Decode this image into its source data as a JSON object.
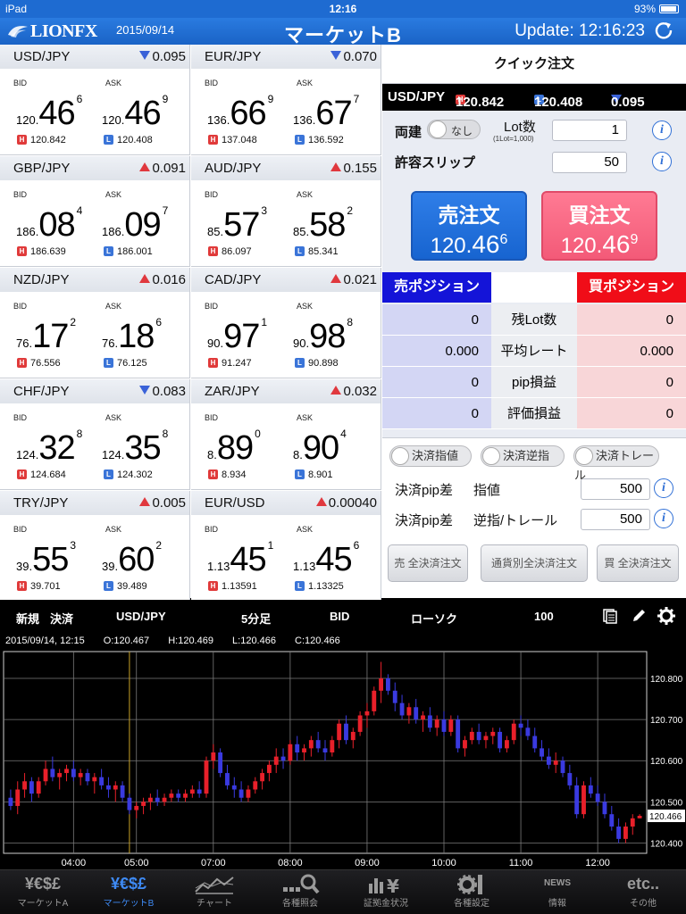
{
  "status": {
    "device": "iPad",
    "time": "12:16",
    "battery": "93%"
  },
  "header": {
    "logo": "LIONFX",
    "date": "2015/09/14",
    "title": "マーケットB",
    "update": "Update: 12:16:23"
  },
  "labels": {
    "bid": "BID",
    "ask": "ASK",
    "h": "H",
    "l": "L"
  },
  "rates": [
    {
      "pair": "USD/JPY",
      "dir": "down",
      "change": "0.095",
      "bid": {
        "a": "120.",
        "b": "46",
        "c": "6"
      },
      "ask": {
        "a": "120.",
        "b": "46",
        "c": "9"
      },
      "high": "120.842",
      "low": "120.408"
    },
    {
      "pair": "EUR/JPY",
      "dir": "down",
      "change": "0.070",
      "bid": {
        "a": "136.",
        "b": "66",
        "c": "9"
      },
      "ask": {
        "a": "136.",
        "b": "67",
        "c": "7"
      },
      "high": "137.048",
      "low": "136.592"
    },
    {
      "pair": "GBP/JPY",
      "dir": "up",
      "change": "0.091",
      "bid": {
        "a": "186.",
        "b": "08",
        "c": "4"
      },
      "ask": {
        "a": "186.",
        "b": "09",
        "c": "7"
      },
      "high": "186.639",
      "low": "186.001"
    },
    {
      "pair": "AUD/JPY",
      "dir": "up",
      "change": "0.155",
      "bid": {
        "a": "85.",
        "b": "57",
        "c": "3"
      },
      "ask": {
        "a": "85.",
        "b": "58",
        "c": "2"
      },
      "high": "86.097",
      "low": "85.341"
    },
    {
      "pair": "NZD/JPY",
      "dir": "up",
      "change": "0.016",
      "bid": {
        "a": "76.",
        "b": "17",
        "c": "2"
      },
      "ask": {
        "a": "76.",
        "b": "18",
        "c": "6"
      },
      "high": "76.556",
      "low": "76.125"
    },
    {
      "pair": "CAD/JPY",
      "dir": "up",
      "change": "0.021",
      "bid": {
        "a": "90.",
        "b": "97",
        "c": "1"
      },
      "ask": {
        "a": "90.",
        "b": "98",
        "c": "8"
      },
      "high": "91.247",
      "low": "90.898"
    },
    {
      "pair": "CHF/JPY",
      "dir": "down",
      "change": "0.083",
      "bid": {
        "a": "124.",
        "b": "32",
        "c": "8"
      },
      "ask": {
        "a": "124.",
        "b": "35",
        "c": "8"
      },
      "high": "124.684",
      "low": "124.302"
    },
    {
      "pair": "ZAR/JPY",
      "dir": "up",
      "change": "0.032",
      "bid": {
        "a": "8.",
        "b": "89",
        "c": "0"
      },
      "ask": {
        "a": "8.",
        "b": "90",
        "c": "4"
      },
      "high": "8.934",
      "low": "8.901"
    },
    {
      "pair": "TRY/JPY",
      "dir": "up",
      "change": "0.005",
      "bid": {
        "a": "39.",
        "b": "55",
        "c": "3"
      },
      "ask": {
        "a": "39.",
        "b": "60",
        "c": "2"
      },
      "high": "39.701",
      "low": "39.489"
    },
    {
      "pair": "EUR/USD",
      "dir": "up",
      "change": "0.00040",
      "bid": {
        "a": "1.13",
        "b": "45",
        "c": "1"
      },
      "ask": {
        "a": "1.13",
        "b": "45",
        "c": "6"
      },
      "high": "1.13591",
      "low": "1.13325"
    }
  ],
  "quick": {
    "title": "クイック注文",
    "pair": "USD/JPY",
    "high": "120.842",
    "low": "120.408",
    "change": "0.095",
    "ryodate_label": "両建",
    "ryodate_value": "なし",
    "lot_label": "Lot数",
    "lot_note": "(1Lot=1,000)",
    "lot_value": "1",
    "slip_label": "許容スリップ",
    "slip_value": "50",
    "sell_label": "売注文",
    "sell_price": {
      "a": "120.",
      "b": "46",
      "c": "6"
    },
    "buy_label": "買注文",
    "buy_price": {
      "a": "120.",
      "b": "46",
      "c": "9"
    },
    "sell_pos_header": "売ポジション",
    "buy_pos_header": "買ポジション",
    "positions": [
      {
        "label": "残Lot数",
        "sell": "0",
        "buy": "0"
      },
      {
        "label": "平均レート",
        "sell": "0.000",
        "buy": "0.000"
      },
      {
        "label": "pip損益",
        "sell": "0",
        "buy": "0"
      },
      {
        "label": "評価損益",
        "sell": "0",
        "buy": "0"
      }
    ],
    "settle_toggles": [
      "決済指値",
      "決済逆指",
      "決済トレール"
    ],
    "pip_limit_label1": "決済pip差",
    "pip_limit_label2": "指値",
    "pip_limit_value": "500",
    "pip_stop_label1": "決済pip差",
    "pip_stop_label2": "逆指/トレール",
    "pip_stop_value": "500",
    "btn_sell_all": "売 全決済注文",
    "btn_pair_all": "通貨別全決済注文",
    "btn_buy_all": "買 全決済注文",
    "info_icon": "i"
  },
  "chart_toolbar": {
    "new": "新規",
    "settle": "決済",
    "pair": "USD/JPY",
    "period": "5分足",
    "side": "BID",
    "type": "ローソク",
    "count": "100"
  },
  "chart_data": {
    "type": "candlestick",
    "ohlc_date": "2015/09/14, 12:15",
    "ohlc": {
      "o": "O:120.467",
      "h": "H:120.469",
      "l": "L:120.466",
      "c": "C:120.466"
    },
    "current_label": "120.466",
    "current": 120.466,
    "x_ticks": [
      "04:00",
      "05:00",
      "07:00",
      "08:00",
      "09:00",
      "10:00",
      "11:00",
      "12:00"
    ],
    "y_ticks": [
      "120.800",
      "120.700",
      "120.600",
      "120.500",
      "120.400"
    ],
    "y_tick_values": [
      120.8,
      120.7,
      120.6,
      120.5,
      120.4
    ],
    "ylim": [
      120.375,
      120.865
    ],
    "cursor_index": 17,
    "candles": [
      [
        120.51,
        120.53,
        120.48,
        120.49
      ],
      [
        120.49,
        120.55,
        120.47,
        120.53
      ],
      [
        120.53,
        120.57,
        120.51,
        120.55
      ],
      [
        120.55,
        120.56,
        120.5,
        120.52
      ],
      [
        120.52,
        120.56,
        120.51,
        120.55
      ],
      [
        120.55,
        120.6,
        120.54,
        120.58
      ],
      [
        120.58,
        120.61,
        120.55,
        120.56
      ],
      [
        120.56,
        120.58,
        120.53,
        120.57
      ],
      [
        120.57,
        120.59,
        120.55,
        120.58
      ],
      [
        120.58,
        120.6,
        120.55,
        120.56
      ],
      [
        120.56,
        120.58,
        120.54,
        120.57
      ],
      [
        120.57,
        120.58,
        120.54,
        120.55
      ],
      [
        120.55,
        120.57,
        120.52,
        120.56
      ],
      [
        120.56,
        120.58,
        120.53,
        120.54
      ],
      [
        120.54,
        120.56,
        120.51,
        120.53
      ],
      [
        120.53,
        120.55,
        120.5,
        120.54
      ],
      [
        120.54,
        120.55,
        120.5,
        120.51
      ],
      [
        120.51,
        120.52,
        120.47,
        120.48
      ],
      [
        120.48,
        120.5,
        120.46,
        120.49
      ],
      [
        120.49,
        120.51,
        120.47,
        120.5
      ],
      [
        120.5,
        120.52,
        120.48,
        120.51
      ],
      [
        120.51,
        120.53,
        120.49,
        120.5
      ],
      [
        120.5,
        120.52,
        120.49,
        120.51
      ],
      [
        120.51,
        120.53,
        120.5,
        120.52
      ],
      [
        120.52,
        120.53,
        120.5,
        120.51
      ],
      [
        120.51,
        120.53,
        120.5,
        120.52
      ],
      [
        120.52,
        120.54,
        120.51,
        120.53
      ],
      [
        120.53,
        120.55,
        120.51,
        120.52
      ],
      [
        120.52,
        120.61,
        120.51,
        120.6
      ],
      [
        120.6,
        120.64,
        120.58,
        120.62
      ],
      [
        120.62,
        120.63,
        120.56,
        120.57
      ],
      [
        120.57,
        120.59,
        120.53,
        120.54
      ],
      [
        120.54,
        120.56,
        120.51,
        120.53
      ],
      [
        120.53,
        120.55,
        120.5,
        120.51
      ],
      [
        120.51,
        120.54,
        120.5,
        120.53
      ],
      [
        120.53,
        120.56,
        120.52,
        120.55
      ],
      [
        120.55,
        120.58,
        120.53,
        120.57
      ],
      [
        120.57,
        120.6,
        120.55,
        120.59
      ],
      [
        120.59,
        120.63,
        120.57,
        120.61
      ],
      [
        120.61,
        120.63,
        120.58,
        120.6
      ],
      [
        120.6,
        120.65,
        120.59,
        120.64
      ],
      [
        120.64,
        120.66,
        120.6,
        120.62
      ],
      [
        120.62,
        120.64,
        120.6,
        120.63
      ],
      [
        120.63,
        120.66,
        120.61,
        120.65
      ],
      [
        120.65,
        120.67,
        120.62,
        120.63
      ],
      [
        120.63,
        120.65,
        120.6,
        120.62
      ],
      [
        120.62,
        120.66,
        120.61,
        120.65
      ],
      [
        120.65,
        120.7,
        120.63,
        120.69
      ],
      [
        120.69,
        120.71,
        120.64,
        120.65
      ],
      [
        120.65,
        120.68,
        120.63,
        120.67
      ],
      [
        120.67,
        120.72,
        120.66,
        120.71
      ],
      [
        120.71,
        120.74,
        120.68,
        120.72
      ],
      [
        120.72,
        120.78,
        120.71,
        120.77
      ],
      [
        120.77,
        120.84,
        120.74,
        120.8
      ],
      [
        120.8,
        120.81,
        120.76,
        120.77
      ],
      [
        120.77,
        120.79,
        120.72,
        120.74
      ],
      [
        120.74,
        120.76,
        120.7,
        120.71
      ],
      [
        120.71,
        120.74,
        120.69,
        120.73
      ],
      [
        120.73,
        120.75,
        120.69,
        120.7
      ],
      [
        120.7,
        120.72,
        120.67,
        120.71
      ],
      [
        120.71,
        120.73,
        120.67,
        120.68
      ],
      [
        120.68,
        120.71,
        120.66,
        120.7
      ],
      [
        120.7,
        120.72,
        120.66,
        120.67
      ],
      [
        120.67,
        120.71,
        120.66,
        120.7
      ],
      [
        120.7,
        120.71,
        120.62,
        120.63
      ],
      [
        120.63,
        120.66,
        120.61,
        120.65
      ],
      [
        120.65,
        120.68,
        120.64,
        120.67
      ],
      [
        120.67,
        120.69,
        120.64,
        120.65
      ],
      [
        120.65,
        120.67,
        120.63,
        120.66
      ],
      [
        120.66,
        120.68,
        120.64,
        120.67
      ],
      [
        120.67,
        120.68,
        120.62,
        120.63
      ],
      [
        120.63,
        120.66,
        120.62,
        120.65
      ],
      [
        120.65,
        120.7,
        120.64,
        120.69
      ],
      [
        120.69,
        120.71,
        120.66,
        120.68
      ],
      [
        120.68,
        120.7,
        120.65,
        120.66
      ],
      [
        120.66,
        120.68,
        120.62,
        120.63
      ],
      [
        120.63,
        120.65,
        120.6,
        120.61
      ],
      [
        120.61,
        120.63,
        120.58,
        120.59
      ],
      [
        120.59,
        120.62,
        120.57,
        120.6
      ],
      [
        120.6,
        120.61,
        120.56,
        120.57
      ],
      [
        120.57,
        120.59,
        120.53,
        120.54
      ],
      [
        120.54,
        120.56,
        120.46,
        120.47
      ],
      [
        120.47,
        120.55,
        120.46,
        120.54
      ],
      [
        120.54,
        120.56,
        120.51,
        120.52
      ],
      [
        120.52,
        120.54,
        120.49,
        120.5
      ],
      [
        120.5,
        120.52,
        120.46,
        120.47
      ],
      [
        120.47,
        120.49,
        120.43,
        120.44
      ],
      [
        120.44,
        120.46,
        120.4,
        120.41
      ],
      [
        120.41,
        120.45,
        120.4,
        120.44
      ],
      [
        120.44,
        120.47,
        120.42,
        120.46
      ],
      [
        120.46,
        120.47,
        120.46,
        120.466
      ]
    ]
  },
  "tabs": [
    {
      "icon": "¥€$£",
      "label": "マーケットA"
    },
    {
      "icon": "¥€$£",
      "label": "マーケットB"
    },
    {
      "icon": "",
      "label": "チャート"
    },
    {
      "icon": "",
      "label": "各種照会"
    },
    {
      "icon": "",
      "label": "証拠金状況"
    },
    {
      "icon": "",
      "label": "各種設定"
    },
    {
      "icon": "NEWS",
      "label": "情報"
    },
    {
      "icon": "etc..",
      "label": "その他"
    }
  ],
  "colors": {
    "up": "#e0383e",
    "down": "#3a62d8",
    "accent": "#1e6bd1",
    "candle_up": "#e8202a",
    "candle_down": "#3a3ae0"
  }
}
